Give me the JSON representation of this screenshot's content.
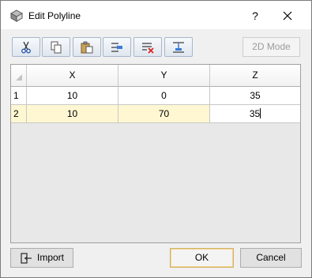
{
  "window": {
    "title": "Edit Polyline",
    "help_glyph": "?"
  },
  "toolbar": {
    "tools": [
      {
        "name": "cut",
        "icon": "scissors-icon"
      },
      {
        "name": "copy",
        "icon": "copy-icon"
      },
      {
        "name": "paste",
        "icon": "paste-icon"
      },
      {
        "name": "insert-row",
        "icon": "insert-row-icon"
      },
      {
        "name": "delete-row",
        "icon": "delete-row-icon"
      },
      {
        "name": "append-row",
        "icon": "append-row-icon"
      }
    ],
    "mode_label": "2D Mode"
  },
  "grid": {
    "columns": [
      "X",
      "Y",
      "Z"
    ],
    "rows": [
      {
        "num": "1",
        "x": "10",
        "y": "0",
        "z": "35"
      },
      {
        "num": "2",
        "x": "10",
        "y": "70",
        "z": "35"
      }
    ]
  },
  "footer": {
    "import_label": "Import",
    "ok_label": "OK",
    "cancel_label": "Cancel"
  },
  "colors": {
    "selected_row": "#fff7d1",
    "toolbar_border": "#a9b7c9",
    "ok_border": "#d0b36b"
  }
}
